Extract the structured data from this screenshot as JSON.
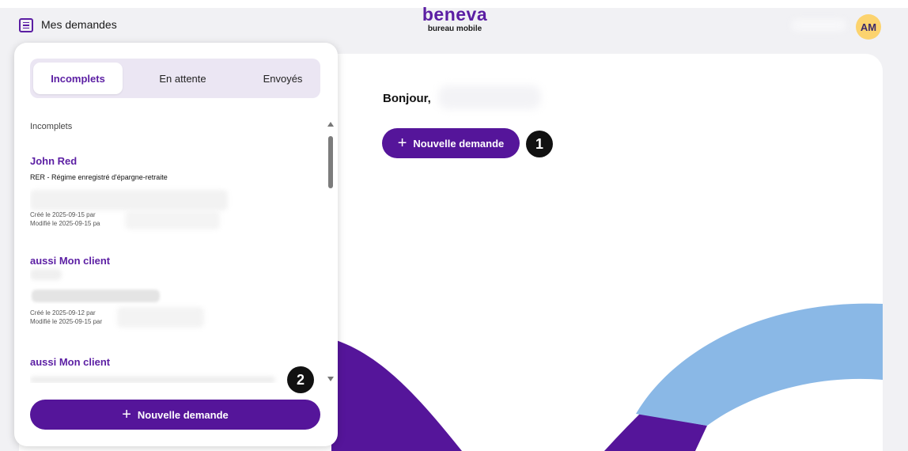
{
  "header": {
    "title": "Mes demandes",
    "menu_icon": "list-menu-icon",
    "logo_name": "beneva",
    "logo_sub": "bureau mobile",
    "avatar_initials": "AM"
  },
  "main": {
    "greeting": "Bonjour,",
    "new_request_label": "Nouvelle demande",
    "marker_1": "1"
  },
  "panel": {
    "tabs": [
      {
        "label": "Incomplets",
        "active": true
      },
      {
        "label": "En attente",
        "active": false
      },
      {
        "label": "Envoyés",
        "active": false
      }
    ],
    "section_label": "Incomplets",
    "items": [
      {
        "name": "John Red",
        "type": "RER - Régime enregistré d'épargne-retraite",
        "created": "Créé le 2025-09-15 par",
        "modified": "Modifié le 2025-09-15 pa"
      },
      {
        "name": "aussi Mon client",
        "type": "",
        "created": "Créé le 2025-09-12 par",
        "modified": "Modifié le 2025-09-15 par"
      },
      {
        "name": "aussi Mon client",
        "type": "",
        "created": "",
        "modified": ""
      }
    ],
    "new_request_label": "Nouvelle demande",
    "marker_2": "2"
  },
  "colors": {
    "brand_purple": "#55159a",
    "accent_blue": "#8ab8e6",
    "avatar_yellow": "#fcd36e",
    "tab_bg": "#ebe6f3"
  }
}
